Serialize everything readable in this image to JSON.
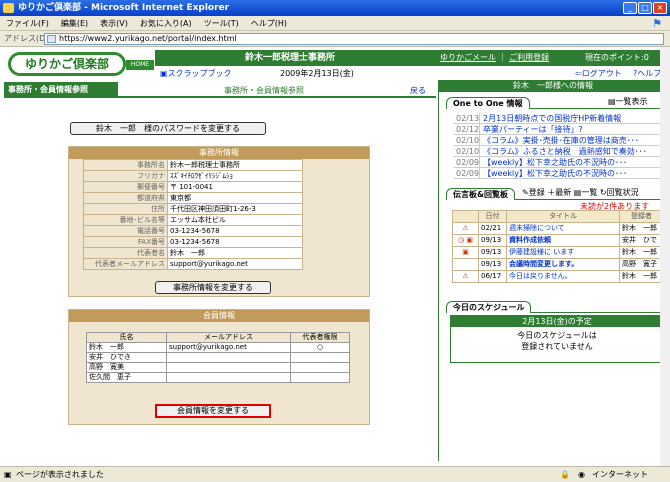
{
  "window": {
    "title": "ゆりかご倶楽部 - Microsoft Internet Explorer",
    "min": "_",
    "max": "□",
    "close": "×"
  },
  "menu": [
    "ファイル(F)",
    "編集(E)",
    "表示(V)",
    "お気に入り(A)",
    "ツール(T)",
    "ヘルプ(H)"
  ],
  "address": {
    "label": "アドレス(D)",
    "url": "https://www2.yurikago.net/portal/index.html"
  },
  "header": {
    "logo": "ゆりかご倶楽部",
    "home": "HOME",
    "office_name": "鈴木一郎税理士事務所",
    "mail_link": "ゆりかごメール",
    "register_link": "ご利用登録",
    "points": "現在のポイント:0",
    "scrapbook": "スクラップブック",
    "date": "2009年2月13日(金)",
    "logout": "ログアウト",
    "help": "ヘルプ"
  },
  "left": {
    "heading": "事務所・会員情報参照",
    "sub": "事務所・会員情報参照",
    "back": "戻る",
    "pw_button": "鈴木　一郎　様のパスワードを変更する"
  },
  "office": {
    "title": "事務所情報",
    "rows": [
      {
        "k": "事務所名",
        "v": "鈴木一郎税理士事務所"
      },
      {
        "k": "フリガナ",
        "v": "ｽｽﾞｷｲﾁﾛｳｾﾞｲﾘｼｼﾞﾑｼｮ"
      },
      {
        "k": "郵便番号",
        "v": "〒 101-0041"
      },
      {
        "k": "都道府県",
        "v": "東京都"
      },
      {
        "k": "住所",
        "v": "千代田区神田須田町1-26-3"
      },
      {
        "k": "番地･ビル名等",
        "v": "エッサム本社ビル"
      },
      {
        "k": "電話番号",
        "v": "03-1234-5678"
      },
      {
        "k": "FAX番号",
        "v": "03-1234-5678"
      },
      {
        "k": "代表者名",
        "v": "鈴木　一郎"
      },
      {
        "k": "代表者メールアドレス",
        "v": "support@yurikago.net"
      }
    ],
    "edit_button": "事務所情報を変更する"
  },
  "members": {
    "title": "会員情報",
    "headers": [
      "氏名",
      "メールアドレス",
      "代表者権限"
    ],
    "rows": [
      [
        "鈴木　一郎",
        "support@yurikago.net",
        "○"
      ],
      [
        "安井　ひでき",
        "",
        ""
      ],
      [
        "高野　寛美",
        "",
        ""
      ],
      [
        "佐久間　恵子",
        "",
        ""
      ]
    ],
    "edit_button": "会員情報を変更する"
  },
  "right": {
    "heading": "鈴木　一郎様への情報",
    "tab": "One to One 情報",
    "list_all": "一覧表示",
    "news": [
      {
        "d": "02/13",
        "t": "2月13日朝時点での国税庁HP新着情報"
      },
      {
        "d": "02/12",
        "t": "卒業パーティーは「接待」?"
      },
      {
        "d": "02/10",
        "t": "《コラム》実掛･売掛･在庫の管理は商売･･･"
      },
      {
        "d": "02/10",
        "t": "《コラム》ふるさと納税　過熱感知で奏効･･･"
      },
      {
        "d": "02/09",
        "t": "【weekly】松下幸之助氏の不況時の･･･"
      },
      {
        "d": "02/09",
        "t": "【weekly】松下幸之助氏の不況時の･･･"
      }
    ],
    "board_tab": "伝言板&回覧板",
    "board_actions": [
      "登録",
      "最新",
      "一覧",
      "回覧状況"
    ],
    "unread": "未読が2件あります",
    "board_headers": [
      "日付",
      "タイトル",
      "登録者"
    ],
    "board": [
      {
        "d": "02/21",
        "t": "週末掃除について",
        "u": "鈴木　一郎"
      },
      {
        "d": "09/13",
        "t": "資料作成依頼",
        "u": "安井　ひで"
      },
      {
        "d": "09/13",
        "t": "伊藤建設様に います",
        "u": "鈴木　一郎"
      },
      {
        "d": "09/13",
        "t": "会議時間変更します。",
        "u": "高野　寛子"
      },
      {
        "d": "06/17",
        "t": "今日は戻りません。",
        "u": "鈴木　一郎"
      }
    ],
    "sched_tab": "今日のスケジュール",
    "sched_date": "2月13日(金)の予定",
    "sched_msg1": "今日のスケジュールは",
    "sched_msg2": "登録されていません"
  },
  "status": {
    "left": "ページが表示されました",
    "zone": "インターネット"
  }
}
